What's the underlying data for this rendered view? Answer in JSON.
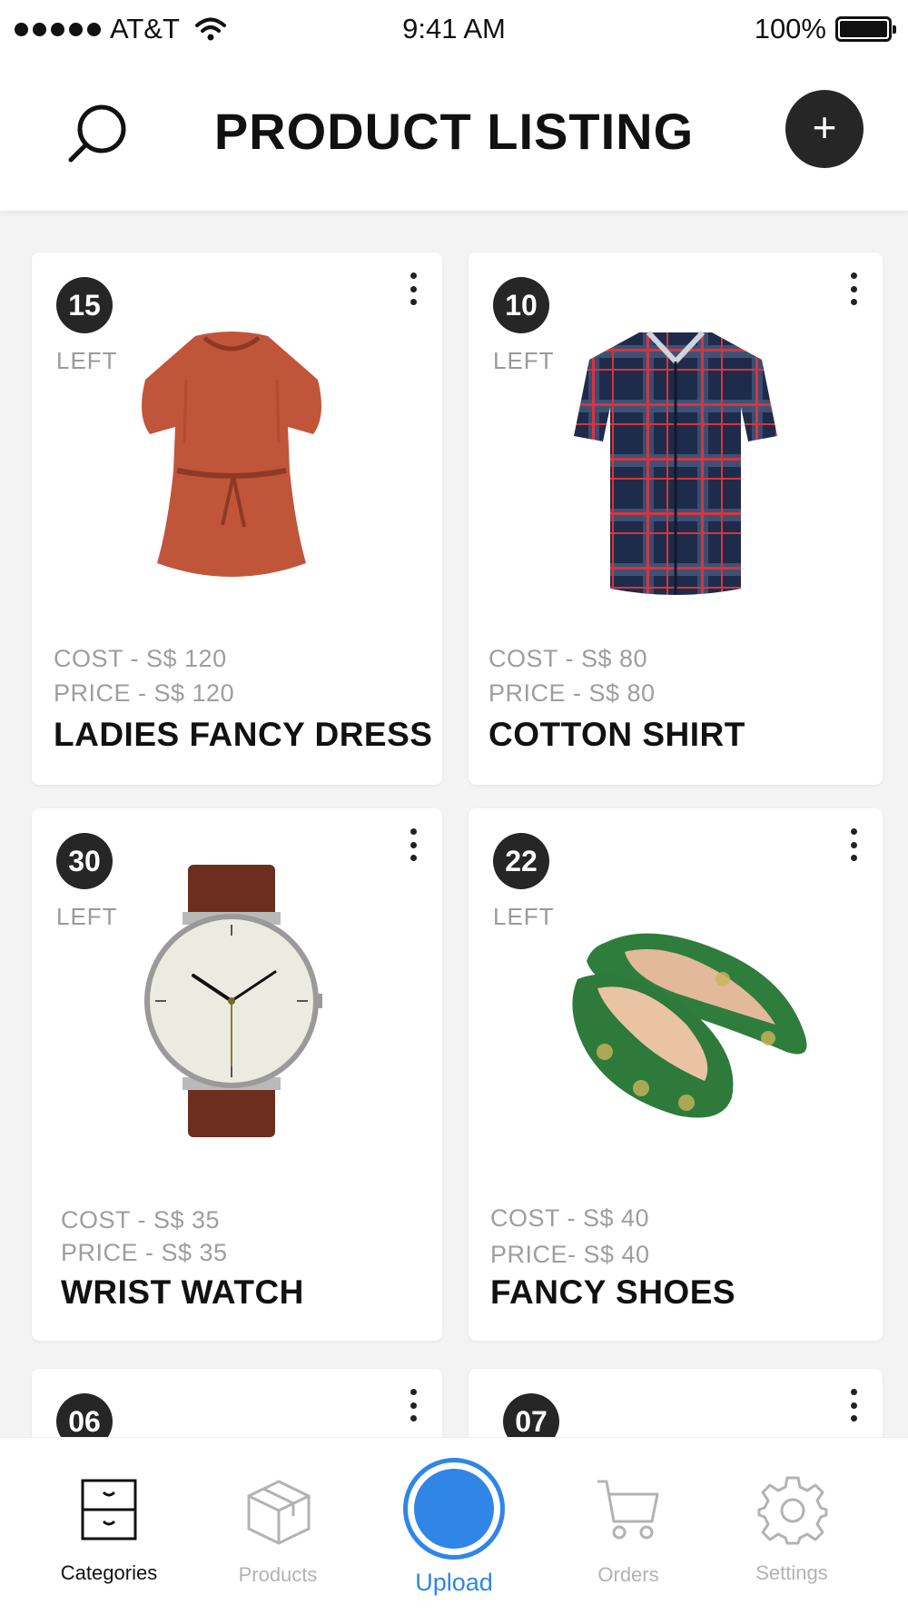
{
  "status_bar": {
    "carrier": "AT&T",
    "time": "9:41 AM",
    "battery": "100%"
  },
  "header": {
    "title": "PRODUCT LISTING",
    "add_label": "+"
  },
  "products": [
    {
      "stock": "15",
      "stock_label": "LEFT",
      "cost": "COST - S$ 120",
      "price": "PRICE - S$ 120",
      "name": "LADIES FANCY DRESS"
    },
    {
      "stock": "10",
      "stock_label": "LEFT",
      "cost": "COST - S$ 80",
      "price": "PRICE - S$ 80",
      "name": "COTTON SHIRT"
    },
    {
      "stock": "30",
      "stock_label": "LEFT",
      "cost": "COST - S$ 35",
      "price": "PRICE - S$ 35",
      "name": "WRIST WATCH"
    },
    {
      "stock": "22",
      "stock_label": "LEFT",
      "cost": "COST - S$ 40",
      "price": "PRICE- S$ 40",
      "name": "FANCY SHOES"
    },
    {
      "stock": "06"
    },
    {
      "stock": "07"
    }
  ],
  "tabs": [
    {
      "label": "Categories",
      "icon": "drawer-cabinet-icon",
      "active": true
    },
    {
      "label": "Products",
      "icon": "box-icon",
      "active": false
    },
    {
      "label": "Upload",
      "icon": "upload-circle-icon",
      "active": false
    },
    {
      "label": "Orders",
      "icon": "cart-icon",
      "active": false
    },
    {
      "label": "Settings",
      "icon": "gear-icon",
      "active": false
    }
  ],
  "colors": {
    "accent": "#2f86e6",
    "badge": "#262626",
    "muted": "#9e9e9e",
    "background": "#f3f3f3"
  }
}
